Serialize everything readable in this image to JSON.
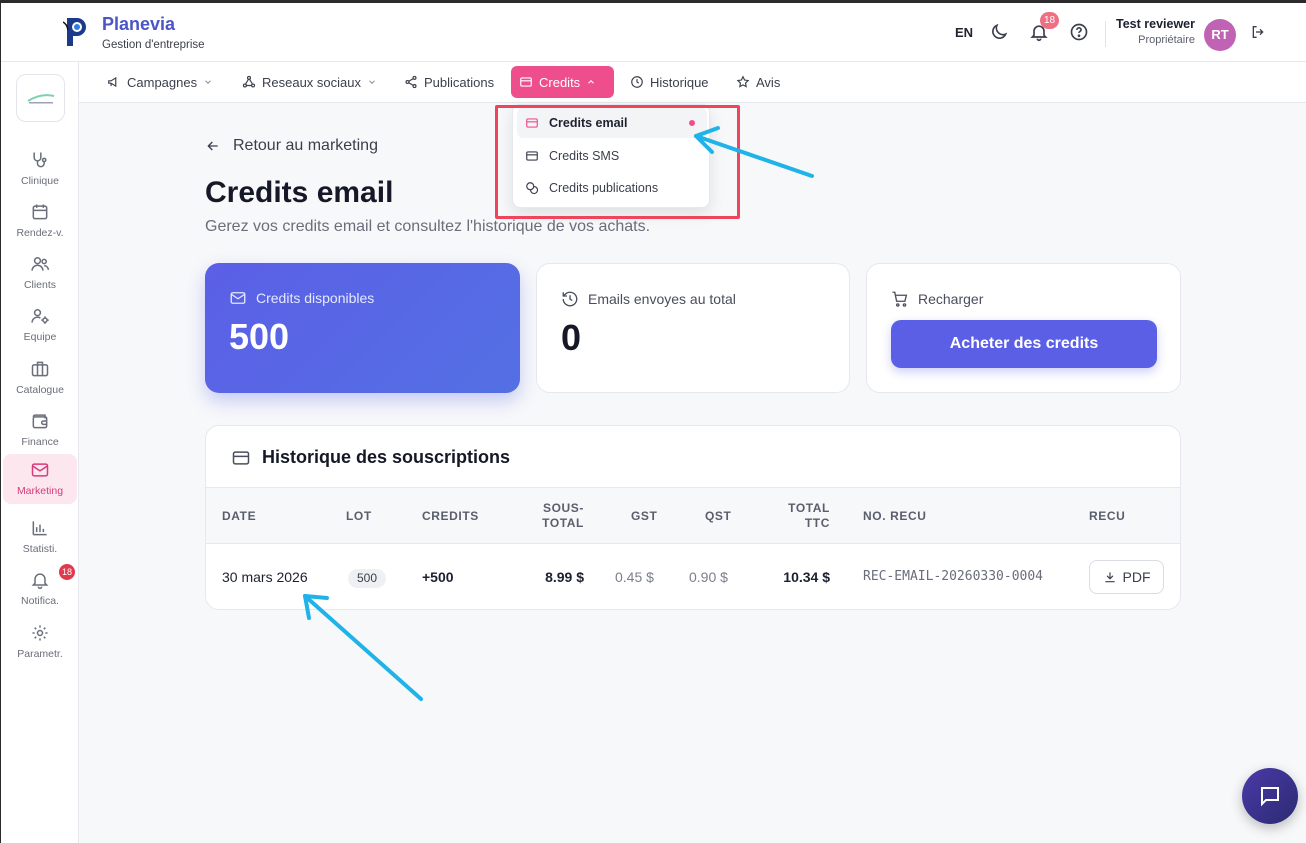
{
  "header": {
    "brand_title": "Planevia",
    "brand_subtitle": "Gestion d'entreprise",
    "language": "EN",
    "notification_count": "18",
    "user_name": "Test reviewer",
    "user_role": "Propriétaire",
    "avatar_initials": "RT"
  },
  "sidebar": {
    "items": [
      {
        "label": "Clinique",
        "icon": "stethoscope-icon"
      },
      {
        "label": "Rendez-v.",
        "icon": "calendar-icon"
      },
      {
        "label": "Clients",
        "icon": "users-icon"
      },
      {
        "label": "Equipe",
        "icon": "team-settings-icon"
      },
      {
        "label": "Catalogue",
        "icon": "briefcase-icon"
      },
      {
        "label": "Finance",
        "icon": "wallet-icon"
      },
      {
        "label": "Marketing",
        "icon": "mail-icon"
      },
      {
        "label": "Statisti.",
        "icon": "bar-chart-icon"
      },
      {
        "label": "Notifica.",
        "icon": "bell-icon"
      },
      {
        "label": "Parametr.",
        "icon": "gear-icon"
      }
    ],
    "notification_badge": "18"
  },
  "subnav": {
    "tabs": [
      {
        "label": "Campagnes"
      },
      {
        "label": "Reseaux sociaux"
      },
      {
        "label": "Publications"
      },
      {
        "label": "Credits"
      },
      {
        "label": "Historique"
      },
      {
        "label": "Avis"
      }
    ]
  },
  "dropdown": {
    "items": [
      {
        "label": "Credits email"
      },
      {
        "label": "Credits SMS"
      },
      {
        "label": "Credits publications"
      }
    ]
  },
  "main": {
    "back_label": "Retour au marketing",
    "title": "Credits email",
    "subtitle": "Gerez vos credits email et consultez l'historique de vos achats.",
    "cards": {
      "available_label": "Credits disponibles",
      "available_value": "500",
      "sent_label": "Emails envoyes au total",
      "sent_value": "0",
      "recharge_label": "Recharger",
      "buy_button": "Acheter des credits"
    },
    "history": {
      "title": "Historique des souscriptions",
      "columns": [
        "DATE",
        "LOT",
        "CREDITS",
        "SOUS-\nTOTAL",
        "GST",
        "QST",
        "TOTAL\nTTC",
        "NO. RECU",
        "RECU"
      ],
      "rows": [
        {
          "date": "30 mars 2026",
          "lot": "500",
          "credits": "+500",
          "subtotal": "8.99 $",
          "gst": "0.45 $",
          "qst": "0.90 $",
          "total": "10.34 $",
          "receipt_no": "REC-EMAIL-20260330-0004",
          "receipt_button": "PDF"
        }
      ]
    }
  },
  "colors": {
    "accent": "#ee4f8c",
    "primary": "#5b5fe6",
    "annotation_arrow": "#1fb3e8",
    "annotation_box": "#f0435c"
  }
}
